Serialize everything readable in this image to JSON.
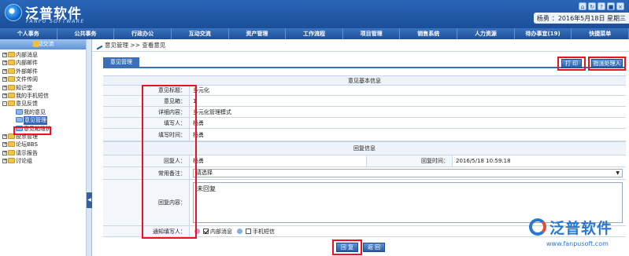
{
  "header": {
    "logo_name": "泛普软件",
    "logo_sub": "FANPU SOFTWARE",
    "user_label": "杨勇",
    "date_text": "：2016年5月18日 星期三"
  },
  "nav": [
    "个人事务",
    "公共事务",
    "行政办公",
    "互动交流",
    "资产管理",
    "工作流程",
    "项目管理",
    "销售系统",
    "人力资源",
    "待办事宜(19)",
    "快捷菜单"
  ],
  "sidebar": {
    "title": "互动交流",
    "items": [
      {
        "label": "内部消息",
        "exp": "+",
        "level": 0
      },
      {
        "label": "内部邮件",
        "exp": "+",
        "level": 0
      },
      {
        "label": "外部邮件",
        "exp": "+",
        "level": 0
      },
      {
        "label": "文件传阅",
        "exp": "+",
        "level": 0
      },
      {
        "label": "知识堂",
        "exp": "+",
        "level": 0
      },
      {
        "label": "我的手机短信",
        "exp": "+",
        "level": 0
      },
      {
        "label": "意见反馈",
        "exp": "-",
        "level": 0
      },
      {
        "label": "我的意见",
        "exp": "",
        "level": 1
      },
      {
        "label": "意见管理",
        "exp": "",
        "level": 1,
        "selected": true
      },
      {
        "label": "意见箱维护",
        "exp": "",
        "level": 1
      },
      {
        "label": "投票管理",
        "exp": "+",
        "level": 0
      },
      {
        "label": "论坛BBS",
        "exp": "+",
        "level": 0
      },
      {
        "label": "请示报告",
        "exp": "+",
        "level": 0
      },
      {
        "label": "讨论组",
        "exp": "+",
        "level": 0
      }
    ]
  },
  "main": {
    "breadcrumb": "意见管理 >> 查看意见",
    "tab": "意见管理",
    "print_label": "打 印",
    "assign_label": "指派处理人",
    "section_basic": "意见基本信息",
    "fields": {
      "title_label": "意见标题：",
      "title_value": "多元化",
      "box_label": "意见箱：",
      "box_value": "1",
      "detail_label": "详细内容：",
      "detail_value": "多元化管理模式",
      "author_label": "填写人：",
      "author_value": "杨勇",
      "time_label": "填写时间：",
      "time_value": "杨勇"
    },
    "section_reply": "回复信息",
    "reply": {
      "replier_label": "回复人：",
      "replier_value": "杨勇",
      "reply_time_label": "回复时间：",
      "reply_time_value": "2016/5/18 10:59:18",
      "remark_label": "常用备注：",
      "remark_value": "请选择",
      "content_label": "回复内容：",
      "content_value": "未回复",
      "notify_label": "通知填写人：",
      "opt_internal": "内部消息",
      "opt_sms": "手机短信"
    },
    "reply_btn": "回 复",
    "back_btn": "返 回"
  },
  "watermark": {
    "name": "泛普软件",
    "url": "www.fanpusoft.com"
  }
}
